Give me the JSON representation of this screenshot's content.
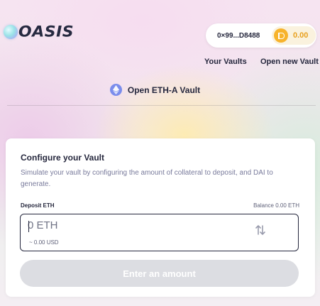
{
  "header": {
    "logo_text": "OASIS",
    "account": {
      "address": "0×99...D8488",
      "dai_balance": "0.00"
    },
    "nav": {
      "your_vaults": "Your Vaults",
      "open_new_vault": "Open new Vault"
    }
  },
  "page": {
    "heading": "Open ETH-A Vault",
    "heading_icon": "eth-icon"
  },
  "card": {
    "title": "Configure your Vault",
    "description": "Simulate your vault by configuring the amount of collateral to deposit, and DAI to generate.",
    "deposit_label": "Deposit ETH",
    "balance_label": "Balance 0.00 ETH",
    "amount_input": {
      "value": "",
      "placeholder": "0 ETH"
    },
    "usd_value": "~ 0.00 USD",
    "swap_icon": "swap-arrows-icon",
    "submit_label": "Enter an amount"
  },
  "colors": {
    "text_primary": "#25273d",
    "text_secondary": "#787a9b",
    "dai_accent": "#f7b32b",
    "eth_accent": "#7b8dec",
    "button_disabled": "#dcdde2"
  }
}
